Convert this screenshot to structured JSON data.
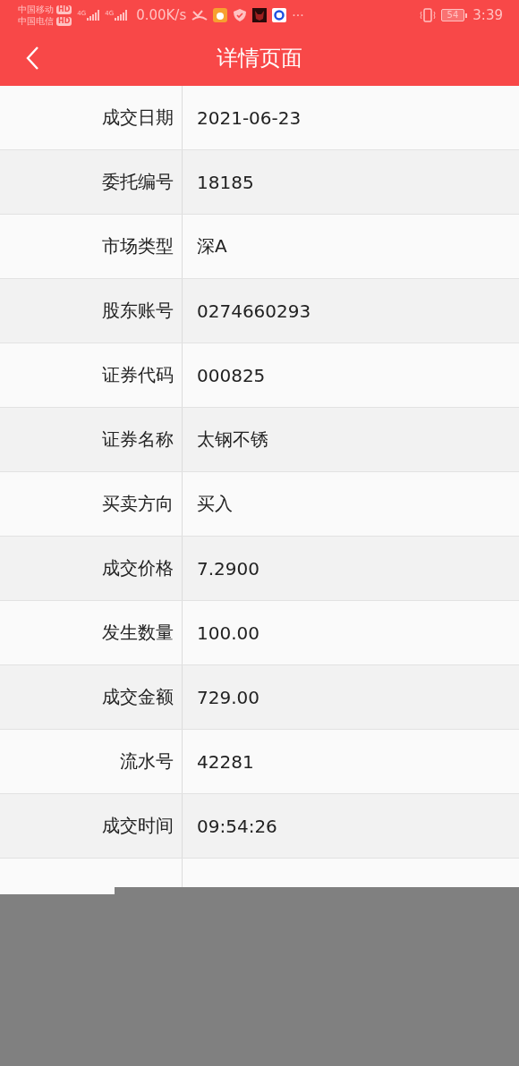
{
  "status_bar": {
    "carriers": [
      {
        "name": "中国移动",
        "badge": "HD"
      },
      {
        "name": "中国电信",
        "badge": "HD"
      }
    ],
    "networks": [
      "4G",
      "4G"
    ],
    "speed": "0.00K/s",
    "more": "···",
    "battery": "54",
    "time": "3:39"
  },
  "header": {
    "title": "详情页面"
  },
  "rows": [
    {
      "label": "成交日期",
      "value": "2021-06-23"
    },
    {
      "label": "委托编号",
      "value": "18185"
    },
    {
      "label": "市场类型",
      "value": "深A"
    },
    {
      "label": "股东账号",
      "value": "0274660293"
    },
    {
      "label": "证券代码",
      "value": "000825"
    },
    {
      "label": "证券名称",
      "value": "太钢不锈"
    },
    {
      "label": "买卖方向",
      "value": "买入"
    },
    {
      "label": "成交价格",
      "value": "7.2900"
    },
    {
      "label": "发生数量",
      "value": "100.00"
    },
    {
      "label": "成交金额",
      "value": "729.00"
    },
    {
      "label": "流水号",
      "value": "42281"
    },
    {
      "label": "成交时间",
      "value": "09:54:26"
    }
  ]
}
